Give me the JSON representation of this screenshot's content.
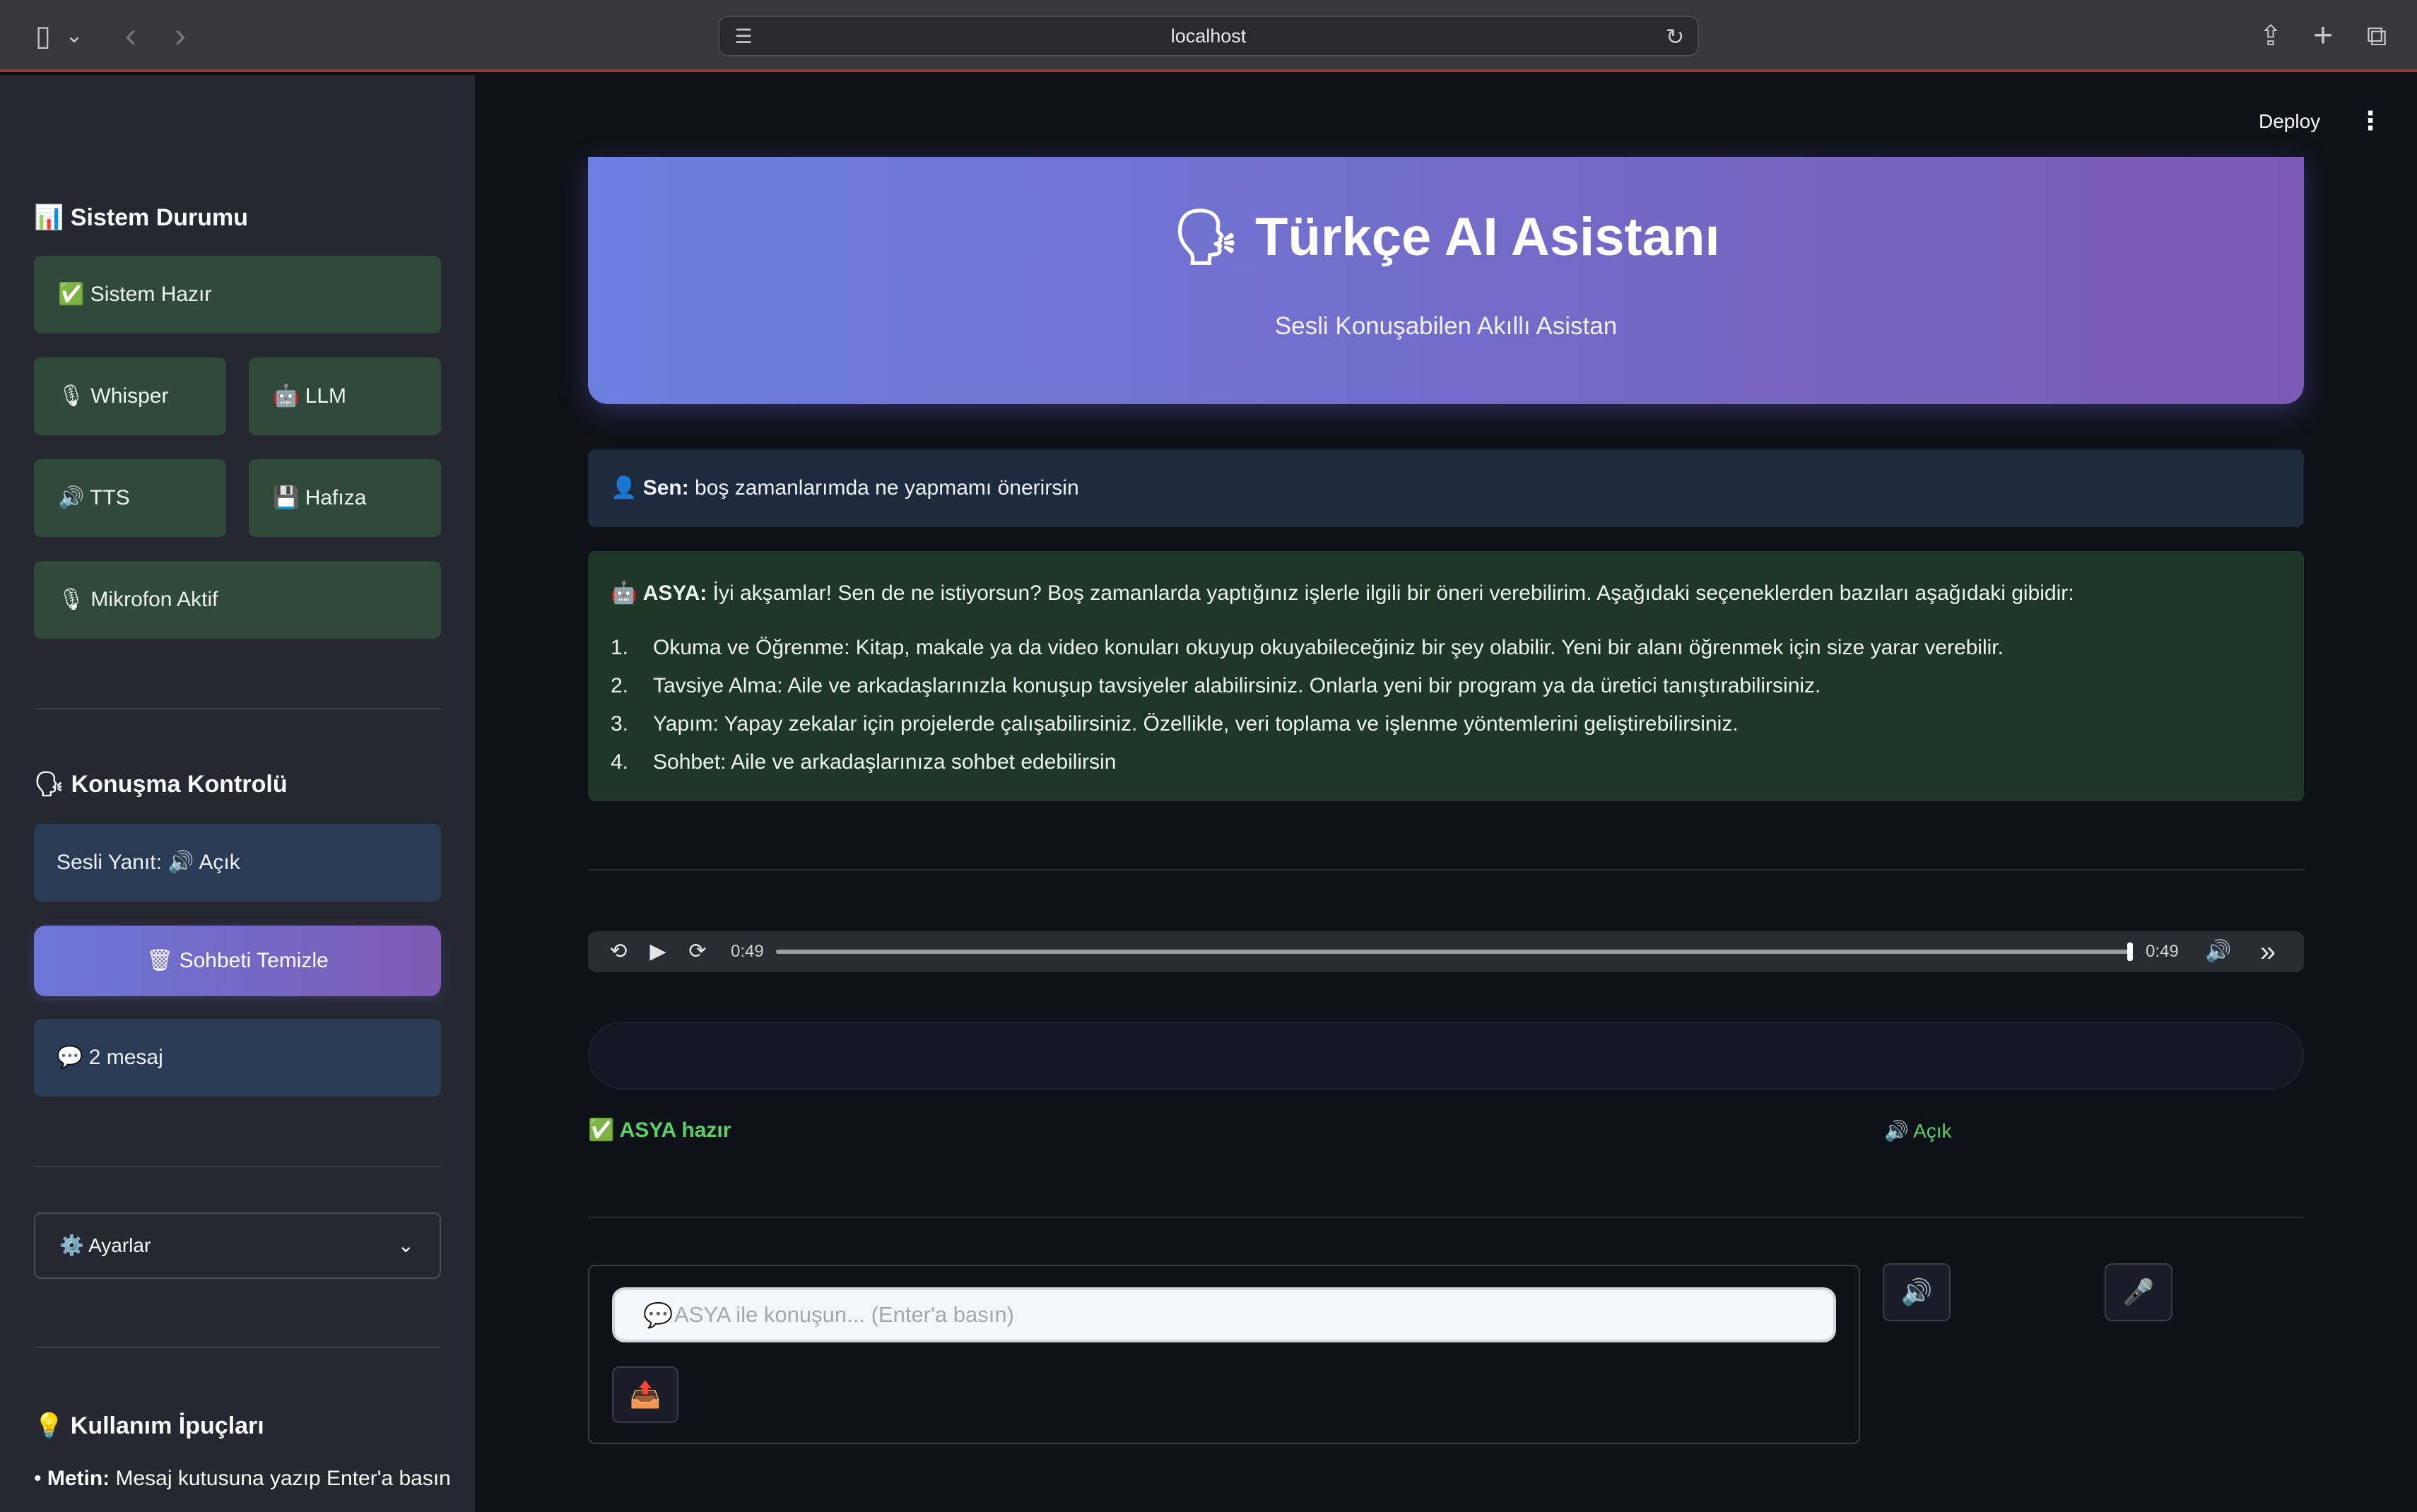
{
  "browser": {
    "url": "localhost",
    "icons": {
      "sidebar_toggle": "▯",
      "chevron_down": "⌄",
      "back": "‹",
      "forward": "›",
      "page_menu": "☰",
      "reload": "↻",
      "share": "⇪",
      "new_tab": "+",
      "tabs": "⧉"
    }
  },
  "sidebar": {
    "system_title": "📊 Sistem Durumu",
    "system_ready": "✅ Sistem Hazır",
    "whisper": "🎙 Whisper",
    "llm": "🤖 LLM",
    "tts": "🔊 TTS",
    "memory": "💾 Hafıza",
    "mic": "🎙 Mikrofon Aktif",
    "conversation_title": "🗣 Konuşma Kontrolü",
    "voice_reply": "Sesli Yanıt: 🔊 Açık",
    "clear_chat": "🗑 Sohbeti Temizle",
    "message_count": "💬 2 mesaj",
    "settings": "⚙️ Ayarlar",
    "settings_chevron": "⌄",
    "tips_title": "💡 Kullanım İpuçları",
    "tip1_label": "Metin:",
    "tip1_text": " Mesaj kutusuna yazıp Enter'a basın"
  },
  "header": {
    "deploy": "Deploy",
    "menu": "⋮"
  },
  "hero": {
    "title": "🗣 Türkçe AI Asistanı",
    "subtitle": "Sesli Konuşabilen Akıllı Asistan"
  },
  "messages": {
    "user_icon": "👤",
    "user_label": "Sen:",
    "user_text": " boş zamanlarımda ne yapmamı önerirsin",
    "bot_icon": "🤖",
    "bot_label": "ASYA:",
    "bot_text": " İyi akşamlar! Sen de ne istiyorsun? Boş zamanlarda yaptığınız işlerle ilgili bir öneri verebilirim. Aşağıdaki seçeneklerden bazıları aşağıdaki gibidir:",
    "bot_items": [
      {
        "num": "1.",
        "text": "Okuma ve Öğrenme: Kitap, makale ya da video konuları okuyup okuyabileceğiniz bir şey olabilir. Yeni bir alanı öğrenmek için size yarar verebilir."
      },
      {
        "num": "2.",
        "text": "Tavsiye Alma: Aile ve arkadaşlarınızla konuşup tavsiyeler alabilirsiniz. Onlarla yeni bir program ya da üretici tanıştırabilirsiniz."
      },
      {
        "num": "3.",
        "text": "Yapım: Yapay zekalar için projelerde çalışabilirsiniz. Özellikle, veri toplama ve işlenme yöntemlerini geliştirebilirsiniz."
      },
      {
        "num": "4.",
        "text": "Sohbet: Aile ve arkadaşlarınıza sohbet edebilirsin"
      }
    ]
  },
  "audio": {
    "rewind": "⟲",
    "play": "▶",
    "forward": "⟳",
    "current_time": "0:49",
    "duration": "0:49",
    "progress": 1.0,
    "volume": "🔊",
    "more": "»"
  },
  "status": {
    "ready": "✅ ASYA hazır",
    "audio_on": "🔊 Açık"
  },
  "input": {
    "icon": "💬",
    "placeholder": "ASYA ile konuşun... (Enter'a basın)",
    "send": "📤",
    "speaker": "🔊",
    "mic": "🎤"
  }
}
